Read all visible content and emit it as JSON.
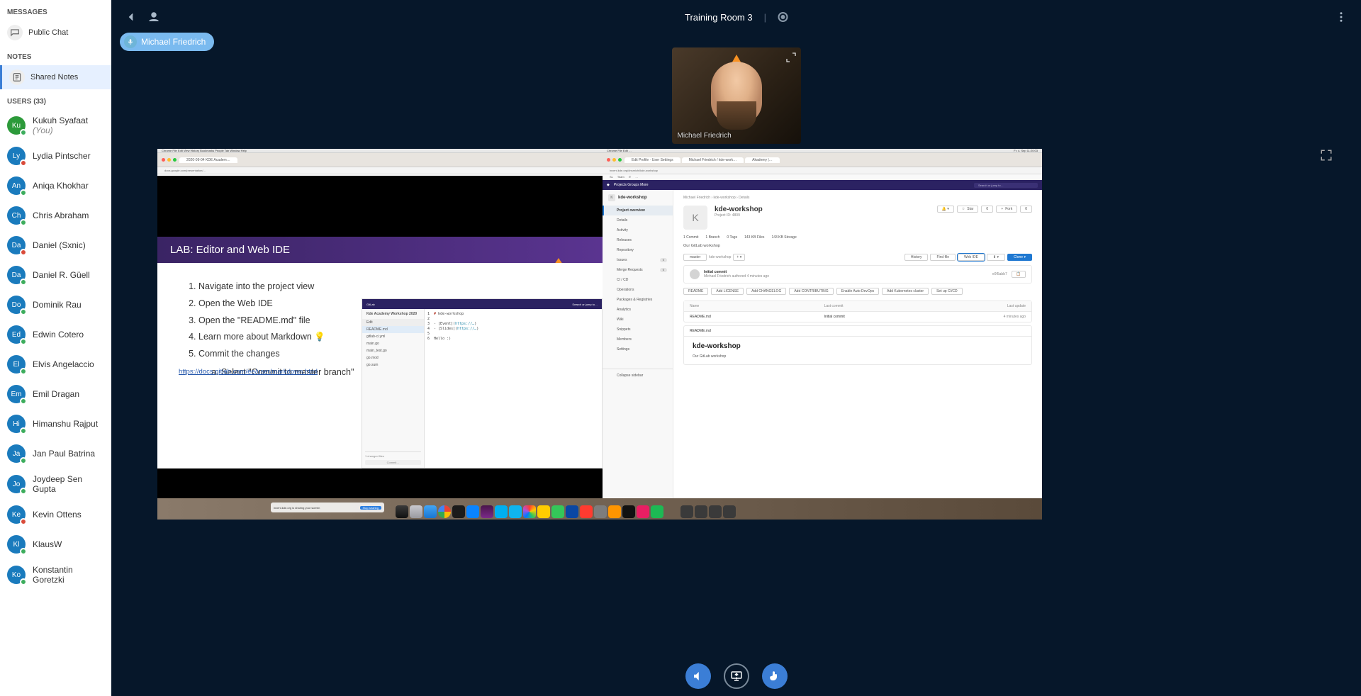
{
  "room": {
    "name": "Training Room 3"
  },
  "speaker_chip": {
    "name": "Michael Friedrich"
  },
  "webcam": {
    "label": "Michael Friedrich"
  },
  "sidebar": {
    "sections": {
      "messages_title": "MESSAGES",
      "notes_title": "NOTES",
      "users_title": "USERS (33)"
    },
    "public_chat": "Public Chat",
    "shared_notes": "Shared Notes",
    "users": [
      {
        "initials": "Ku",
        "name": "Kukuh Syafaat",
        "you_suffix": "(You)",
        "color": "#2c9a3a",
        "status": "green"
      },
      {
        "initials": "Ly",
        "name": "Lydia Pintscher",
        "color": "#1a7bbd",
        "status": "red"
      },
      {
        "initials": "An",
        "name": "Aniqa Khokhar",
        "color": "#1a7bbd",
        "status": "green"
      },
      {
        "initials": "Ch",
        "name": "Chris Abraham",
        "color": "#1a7bbd",
        "status": "green"
      },
      {
        "initials": "Da",
        "name": "Daniel (Sxnic)",
        "color": "#1a7bbd",
        "status": "red"
      },
      {
        "initials": "Da",
        "name": "Daniel R. Güell",
        "color": "#1a7bbd",
        "status": "green"
      },
      {
        "initials": "Do",
        "name": "Dominik Rau",
        "color": "#1a7bbd",
        "status": "green"
      },
      {
        "initials": "Ed",
        "name": "Edwin Cotero",
        "color": "#1a7bbd",
        "status": "green"
      },
      {
        "initials": "El",
        "name": "Elvis Angelaccio",
        "color": "#1a7bbd",
        "status": "green"
      },
      {
        "initials": "Em",
        "name": "Emil Dragan",
        "color": "#1a7bbd",
        "status": "green"
      },
      {
        "initials": "Hi",
        "name": "Himanshu Rajput",
        "color": "#1a7bbd",
        "status": "green"
      },
      {
        "initials": "Ja",
        "name": "Jan Paul Batrina",
        "color": "#1a7bbd",
        "status": "green"
      },
      {
        "initials": "Jo",
        "name": "Joydeep Sen Gupta",
        "color": "#1a7bbd",
        "status": "green"
      },
      {
        "initials": "Ke",
        "name": "Kevin Ottens",
        "color": "#1a7bbd",
        "status": "red"
      },
      {
        "initials": "Kl",
        "name": "KlausW",
        "color": "#1a7bbd",
        "status": "green"
      },
      {
        "initials": "Ko",
        "name": "Konstantin Goretzki",
        "color": "#1a7bbd",
        "status": "green"
      }
    ]
  },
  "screen": {
    "slide": {
      "title": "LAB: Editor and Web IDE",
      "steps": [
        "Navigate into the project view",
        "Open the Web IDE",
        "Open the \"README.md\" file",
        "Learn more about Markdown 💡",
        "Commit the changes"
      ],
      "substep": "Select \"Commit to master branch\"",
      "link": "https://docs.gitlab.com/ee/user/markdown.html"
    },
    "editor_preview": {
      "project": "Kde Academy Workshop 2020",
      "files": [
        "README.md",
        "gitlab-ci.yml",
        "main.go",
        "main_test.go",
        "go.mod",
        "go.sum"
      ],
      "changed_label": "1 changed files",
      "commit_btn": "Commit…"
    },
    "gitlab": {
      "search_placeholder": "Search or jump to…",
      "top_menu": [
        "Projects",
        "Groups",
        "More"
      ],
      "breadcrumb": "Michael Friedrich  ›  kde-workshop  ›  Details",
      "sidebar_title": "kde-workshop",
      "sidebar_items": [
        {
          "label": "Project overview",
          "active": true
        },
        {
          "label": "Details"
        },
        {
          "label": "Activity"
        },
        {
          "label": "Releases"
        },
        {
          "label": "Repository"
        },
        {
          "label": "Issues",
          "badge": "0"
        },
        {
          "label": "Merge Requests",
          "badge": "0"
        },
        {
          "label": "CI / CD"
        },
        {
          "label": "Operations"
        },
        {
          "label": "Packages & Registries"
        },
        {
          "label": "Analytics"
        },
        {
          "label": "Wiki"
        },
        {
          "label": "Snippets"
        },
        {
          "label": "Members"
        },
        {
          "label": "Settings"
        }
      ],
      "collapse": "Collapse sidebar",
      "project": {
        "avatar_letter": "K",
        "name": "kde-workshop",
        "id": "Project ID: 4809",
        "star": "Star",
        "star_count": "0",
        "fork": "Fork",
        "fork_count": "0",
        "stats": [
          "1 Commit",
          "1 Branch",
          "0 Tags",
          "143 KB Files",
          "143 KB Storage"
        ],
        "desc": "Our GitLab workshop"
      },
      "bar": {
        "branch": "master",
        "path": "kde-workshop",
        "history": "History",
        "find": "Find file",
        "webide": "Web IDE",
        "clone": "Clone"
      },
      "commit": {
        "title": "Initial commit",
        "byline": "Michael Friedrich authored 4 minutes ago",
        "sha": "e0f5abb7"
      },
      "badges": [
        "README",
        "Add LICENSE",
        "Add CHANGELOG",
        "Add CONTRIBUTING",
        "Enable Auto DevOps",
        "Add Kubernetes cluster",
        "Set up CI/CD"
      ],
      "table": {
        "head": [
          "Name",
          "Last commit",
          "Last update"
        ],
        "row": [
          "README.md",
          "Initial commit",
          "4 minutes ago"
        ]
      },
      "readme": {
        "file": "README.md",
        "title": "kde-workshop",
        "body": "Our GitLab workshop"
      }
    }
  }
}
